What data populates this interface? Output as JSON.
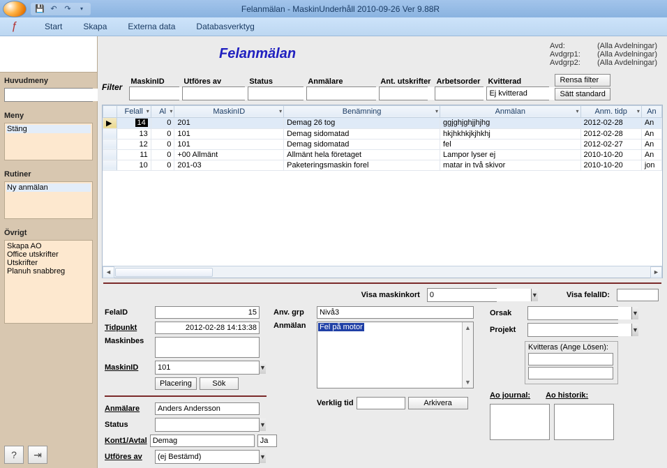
{
  "titlebar": {
    "title": "Felanmälan - MaskinUnderhåll 2010-09-26  Ver 9.88R"
  },
  "ribbon": {
    "tabs": [
      "Start",
      "Skapa",
      "Externa data",
      "Databasverktyg"
    ]
  },
  "leftnav": {
    "huvudmeny_label": "Huvudmeny",
    "meny_label": "Meny",
    "meny_items": [
      "Stäng"
    ],
    "rutiner_label": "Rutiner",
    "rutiner_items": [
      "Ny anmälan"
    ],
    "ovrigt_label": "Övrigt",
    "ovrigt_items": [
      "Skapa AO",
      "Office utskrifter",
      "Utskrifter",
      "Planuh snabbreg"
    ]
  },
  "header": {
    "page_title": "Felanmälan",
    "avd_label": "Avd:",
    "avd_val": "(Alla Avdelningar)",
    "g1_label": "Avdgrp1:",
    "g1_val": "(Alla Avdelningar)",
    "g2_label": "Avdgrp2:",
    "g2_val": "(Alla Avdelningar)"
  },
  "filter": {
    "label": "Filter",
    "cols": {
      "maskinid": "MaskinID",
      "utfores": "Utföres av",
      "status": "Status",
      "anmalare": "Anmälare",
      "antut": "Ant. utskrifter",
      "arbetsorder": "Arbetsorder",
      "kvitterad": "Kvitterad"
    },
    "kvitterad_value": "Ej kvitterad",
    "btn_rensa": "Rensa filter",
    "btn_standard": "Sätt standard"
  },
  "grid": {
    "headers": {
      "felall": "Felall",
      "al": "Al",
      "maskinid": "MaskinID",
      "benamning": "Benämning",
      "anmalan": "Anmälan",
      "anm_tidp": "Anm. tidp",
      "an": "An"
    },
    "rows": [
      {
        "felall": "14",
        "al": "0",
        "mid": "201",
        "ben": "Demag 26 tog",
        "anm": "ggjghjghjjhjhg",
        "tidp": "2012-02-28",
        "an": "An"
      },
      {
        "felall": "13",
        "al": "0",
        "mid": "101",
        "ben": "Demag sidomatad",
        "anm": "hkjhkhkjkjhkhj",
        "tidp": "2012-02-28",
        "an": "An"
      },
      {
        "felall": "12",
        "al": "0",
        "mid": "101",
        "ben": "Demag sidomatad",
        "anm": "fel",
        "tidp": "2012-02-27",
        "an": "An"
      },
      {
        "felall": "11",
        "al": "0",
        "mid": "+00 Allmänt",
        "ben": "Allmänt hela företaget",
        "anm": "Lampor lyser ej",
        "tidp": "2010-10-20",
        "an": "An"
      },
      {
        "felall": "10",
        "al": "0",
        "mid": "201-03",
        "ben": "Paketeringsmaskin forel",
        "anm": "matar in två skivor",
        "tidp": "2010-10-20",
        "an": "jon"
      }
    ]
  },
  "midrow": {
    "visa_maskinkort": "Visa maskinkort",
    "maskinkort_value": "0",
    "visa_felalid": "Visa felalID:"
  },
  "detail": {
    "felaid_label": "FelaID",
    "felaid_value": "15",
    "tidpunkt_label": "Tidpunkt",
    "tidpunkt_value": "2012-02-28 14:13:38",
    "maskinbes_label": "Maskinbes",
    "maskinid_label": "MaskinID",
    "maskinid_value": "101",
    "btn_placering": "Placering",
    "btn_sok": "Sök",
    "anmalare_label": "Anmälare",
    "anmalare_value": "Anders Andersson",
    "status_label": "Status",
    "kont1_label": "Kont1/Avtal",
    "kont1_value": "Demag",
    "kont1_ja": "Ja",
    "utfores_label": "Utföres av",
    "utfores_value": "(ej Bestämd)",
    "anvgrp_label": "Anv. grp",
    "anvgrp_value": "Nivå3",
    "anmalan_label": "Anmälan",
    "anmalan_value": "Fel på motor",
    "verklig_label": "Verklig tid",
    "arkivera_btn": "Arkivera",
    "orsak_label": "Orsak",
    "projekt_label": "Projekt",
    "kvitteras_label": "Kvitteras (Ange Lösen):",
    "ao_journal": "Ao journal:",
    "ao_historik": "Ao historik:"
  }
}
